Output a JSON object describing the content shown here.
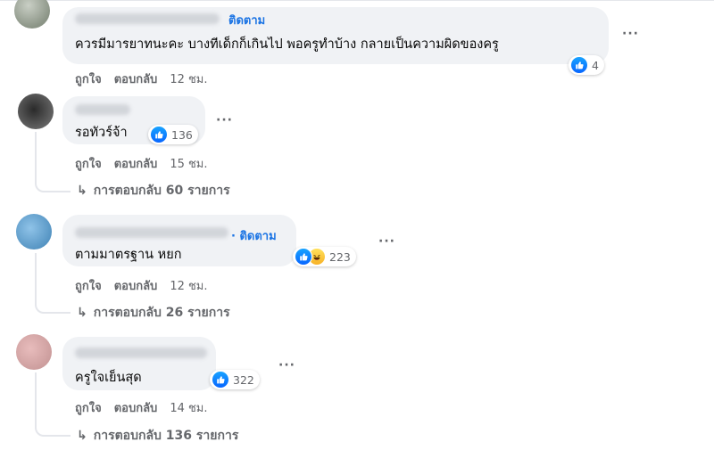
{
  "comments": [
    {
      "follow": "ติดตาม",
      "text": "ควรมีมารยาทนะคะ บางทีเด็กก็เกินไป พอครูทำบ้าง กลายเป็นความผิดของครู",
      "reaction_count": "4",
      "like": "ถูกใจ",
      "reply": "ตอบกลับ",
      "time": "12 ชม."
    },
    {
      "text": "รอทัวร์จ้า",
      "reaction_count": "136",
      "like": "ถูกใจ",
      "reply": "ตอบกลับ",
      "time": "15 ชม.",
      "replies_label": "การตอบกลับ 60 รายการ"
    },
    {
      "follow": "· ติดตาม",
      "text": "ตามมาตรฐาน หยก",
      "reaction_count": "223",
      "like": "ถูกใจ",
      "reply": "ตอบกลับ",
      "time": "12 ชม.",
      "replies_label": "การตอบกลับ 26 รายการ"
    },
    {
      "text": "ครูใจเย็นสุด",
      "reaction_count": "322",
      "like": "ถูกใจ",
      "reply": "ตอบกลับ",
      "time": "14 ชม.",
      "replies_label": "การตอบกลับ 136 รายการ"
    }
  ],
  "more_label": "···",
  "reply_arrow": "↳",
  "colors": {
    "bubble": "#f0f2f5",
    "link": "#1b74e4",
    "meta": "#65676b",
    "like": "#0866ff"
  },
  "icons": {
    "like": "like-reaction-icon",
    "haha": "haha-reaction-icon",
    "reply": "reply-arrow-icon"
  }
}
